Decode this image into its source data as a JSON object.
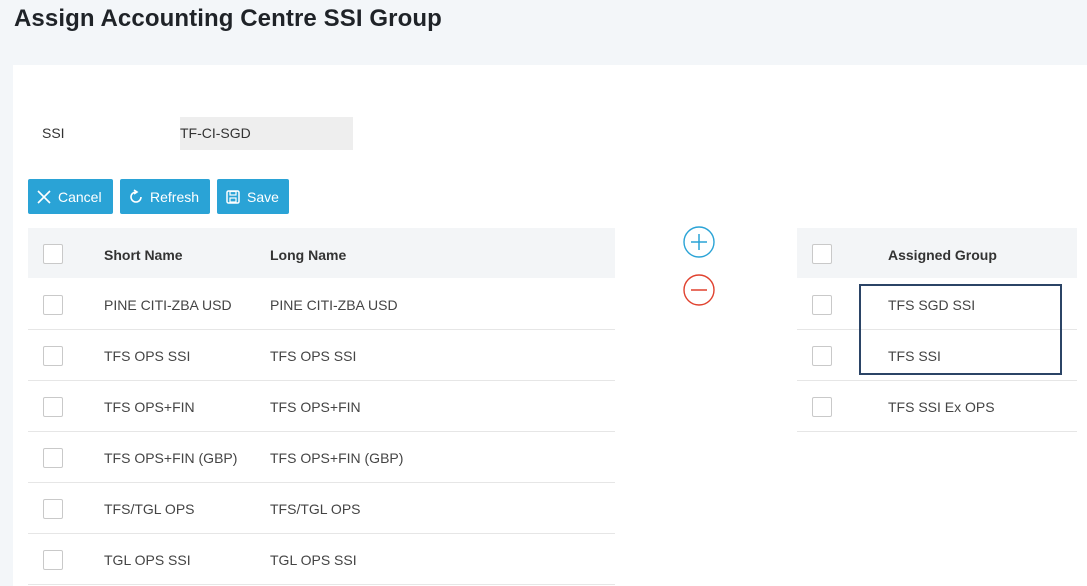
{
  "page": {
    "title": "Assign Accounting Centre SSI Group"
  },
  "form": {
    "ssi_label": "SSI",
    "ssi_value": "TF-CI-SGD"
  },
  "toolbar": {
    "cancel_label": "Cancel",
    "refresh_label": "Refresh",
    "save_label": "Save"
  },
  "left_table": {
    "headers": {
      "short_name": "Short Name",
      "long_name": "Long Name"
    },
    "rows": [
      {
        "short_name": "PINE CITI-ZBA USD",
        "long_name": "PINE CITI-ZBA USD"
      },
      {
        "short_name": "TFS OPS SSI",
        "long_name": "TFS OPS SSI"
      },
      {
        "short_name": "TFS OPS+FIN",
        "long_name": "TFS OPS+FIN"
      },
      {
        "short_name": "TFS OPS+FIN (GBP)",
        "long_name": "TFS OPS+FIN (GBP)"
      },
      {
        "short_name": "TFS/TGL OPS",
        "long_name": "TFS/TGL OPS"
      },
      {
        "short_name": "TGL OPS SSI",
        "long_name": "TGL OPS SSI"
      }
    ]
  },
  "right_table": {
    "headers": {
      "assigned_group": "Assigned Group"
    },
    "rows": [
      {
        "assigned_group": "TFS SGD SSI"
      },
      {
        "assigned_group": "TFS SSI"
      },
      {
        "assigned_group": "TFS SSI Ex OPS"
      }
    ]
  },
  "icons": {
    "cancel": "close-icon",
    "refresh": "refresh-icon",
    "save": "save-icon",
    "add": "plus-circle-icon",
    "remove": "minus-circle-icon"
  },
  "colors": {
    "primary_button": "#2aa3d6",
    "add_icon": "#2aa3d6",
    "remove_icon": "#e0412e",
    "selection_outline": "#2b4466",
    "table_header_bg": "#f3f5f7"
  }
}
